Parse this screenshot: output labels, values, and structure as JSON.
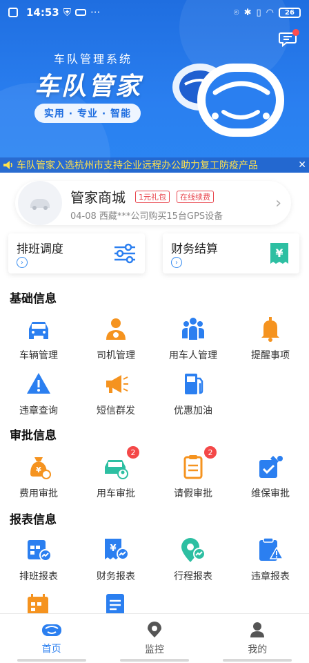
{
  "statusbar": {
    "time": "14:53",
    "battery": "26"
  },
  "hero": {
    "subtitle": "车队管理系统",
    "title": "车队管家",
    "slogan": "实用 · 专业 · 智能",
    "ticker": "车队管家入选杭州市支持企业远程办公助力复工防疫产品"
  },
  "mall": {
    "title": "管家商城",
    "tag1": "1元礼包",
    "tag2": "在线续费",
    "desc": "04-08  西藏***公司购买15台GPS设备"
  },
  "quick": {
    "dispatch": "排班调度",
    "finance": "财务结算"
  },
  "sections": {
    "basic": {
      "title": "基础信息",
      "items": [
        "车辆管理",
        "司机管理",
        "用车人管理",
        "提醒事项",
        "违章查询",
        "短信群发",
        "优惠加油"
      ]
    },
    "approval": {
      "title": "审批信息",
      "items": [
        "费用审批",
        "用车审批",
        "请假审批",
        "维保审批"
      ],
      "badges": {
        "car": "2",
        "leave": "2"
      }
    },
    "reports": {
      "title": "报表信息",
      "items": [
        "排班报表",
        "财务报表",
        "行程报表",
        "违章报表"
      ]
    }
  },
  "nav": {
    "home": "首页",
    "monitor": "监控",
    "mine": "我的"
  },
  "colors": {
    "primary": "#2b7ff0",
    "orange": "#f5931f",
    "badge": "#f44848",
    "teal": "#2dbfa2"
  }
}
